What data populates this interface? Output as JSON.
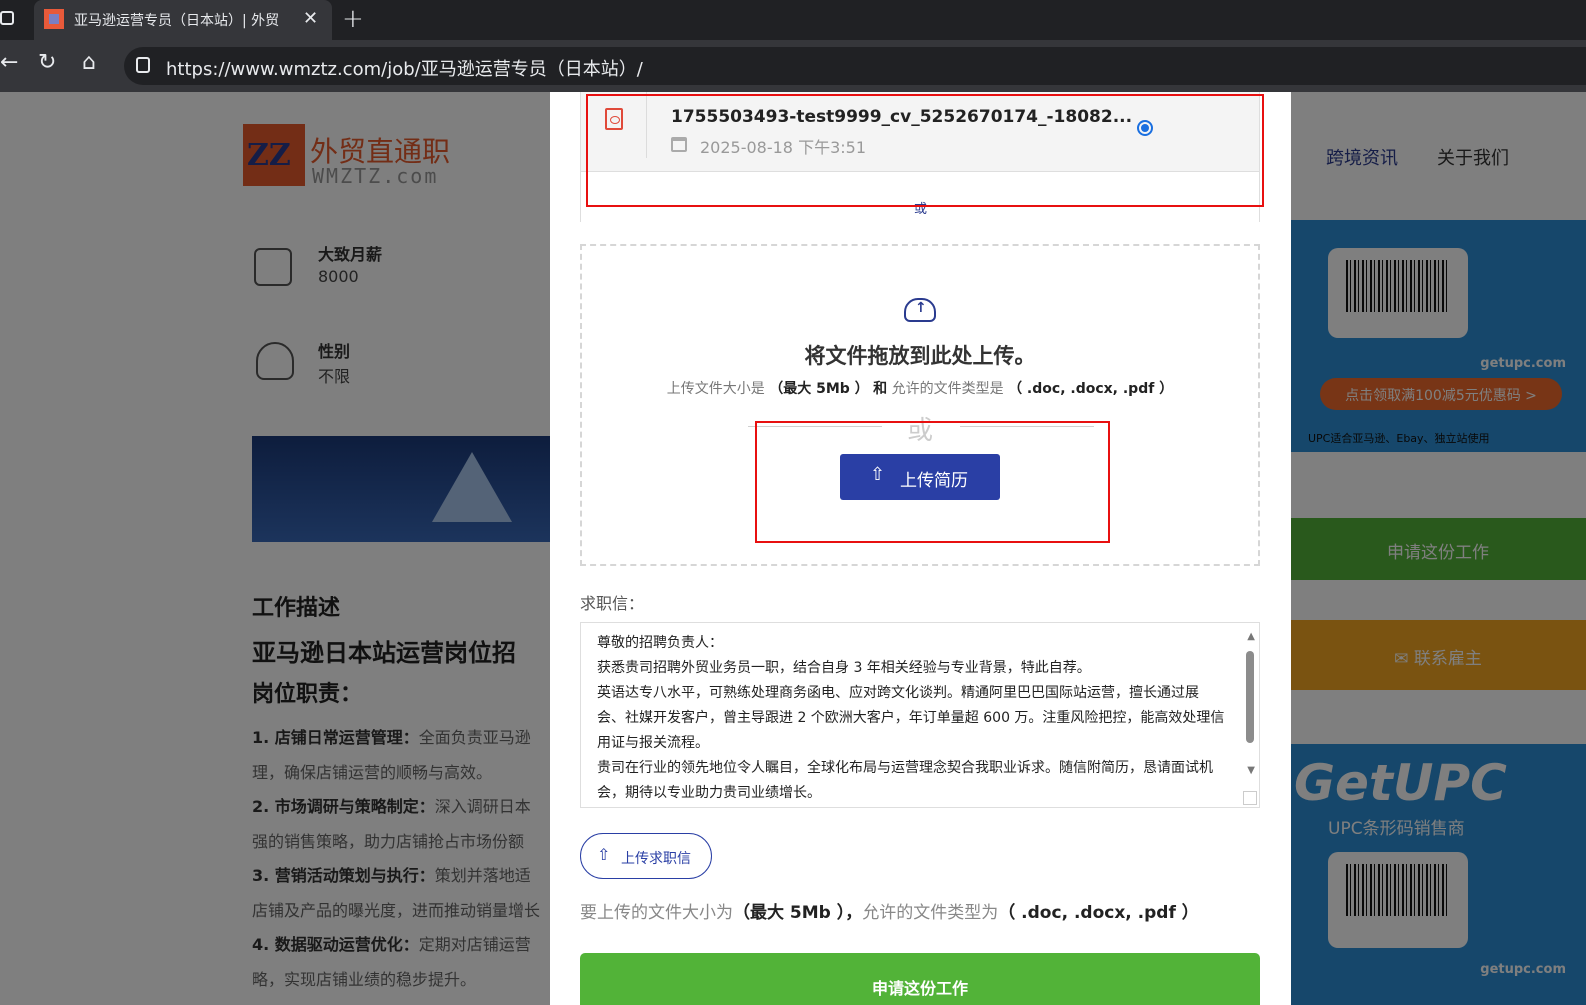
{
  "browser": {
    "tab_title": "亚马逊运营专员（日本站）| 外贸",
    "url": "https://www.wmztz.com/job/亚马逊运营专员（日本站）/"
  },
  "site": {
    "logo_text_cn": "外贸直通职",
    "logo_text_en": "WMZTZ.com",
    "nav": [
      "跨境资讯",
      "关于我们"
    ]
  },
  "job_info": {
    "salary_label": "大致月薪",
    "salary_value": "8000",
    "gender_label": "性别",
    "gender_value": "不限"
  },
  "description": {
    "heading": "工作描述",
    "title": "亚马逊日本站运营岗位招",
    "duties_heading": "岗位职责：",
    "items": [
      {
        "bold": "1. 店铺日常运营管理：",
        "text": "全面负责亚马逊"
      },
      {
        "bold": "",
        "text": "理，确保店铺运营的顺畅与高效。"
      },
      {
        "bold": "2. 市场调研与策略制定：",
        "text": "深入调研日本"
      },
      {
        "bold": "",
        "text": "强的销售策略，助力店铺抢占市场份额"
      },
      {
        "bold": "3. 营销活动策划与执行：",
        "text": "策划并落地适"
      },
      {
        "bold": "",
        "text": "店铺及产品的曝光度，进而推动销量增长"
      },
      {
        "bold": "4. 数据驱动运营优化：",
        "text": "定期对店铺运营"
      },
      {
        "bold": "",
        "text": "略，实现店铺业绩的稳步提升。"
      }
    ]
  },
  "sidebar": {
    "ad_caption": "UPC适合亚马逊、Ebay、独立站使用",
    "ad_cta": "点击领取满100减5元优惠码 >",
    "ad_brand": "getupc.com",
    "ad2_title": "GetUPC",
    "ad2_sub": "UPC条形码销售商",
    "apply_label": "申请这份工作",
    "contact_label": "联系雇主"
  },
  "modal": {
    "resume": {
      "file_name": "1755503493-test9999_cv_5252670174_-18082...",
      "date": "2025-08-18 下午3:51",
      "selected": true
    },
    "or_small": "或",
    "dropzone": {
      "title": "将文件拖放到此处上传。",
      "hint_prefix": "上传文件大小是",
      "hint_size": "（最大 5Mb ）",
      "hint_and": "和",
      "hint_types_label": "允许的文件类型是",
      "hint_types": "（ .doc, .docx, .pdf ）",
      "or": "或",
      "upload_button": "上传简历"
    },
    "cover_letter": {
      "label": "求职信：",
      "paragraphs": [
        "尊敬的招聘负责人：",
        "获悉贵司招聘外贸业务员一职，结合自身 3 年相关经验与专业背景，特此自荐。",
        "英语达专八水平，可熟练处理商务函电、应对跨文化谈判。精通阿里巴巴国际站运营，擅长通过展会、社媒开发客户，曾主导跟进 2 个欧洲大客户，年订单量超 600 万。注重风险把控，能高效处理信用证与报关流程。",
        "贵司在行业的领先地位令人瞩目，全球化布局与运营理念契合我职业诉求。随信附简历，恳请面试机会，期待以专业助力贵司业绩增长。"
      ],
      "upload_button": "上传求职信",
      "hint_prefix": "要上传的文件大小为",
      "hint_size": "（最大 5Mb ）",
      "hint_sep": "，",
      "hint_types_label": "允许的文件类型为",
      "hint_types": "（ .doc, .docx, .pdf ）"
    },
    "apply_button": "申请这份工作"
  },
  "colors": {
    "primary": "#2a3fa5",
    "apply_green": "#52b338",
    "highlight_red": "#e81010"
  }
}
